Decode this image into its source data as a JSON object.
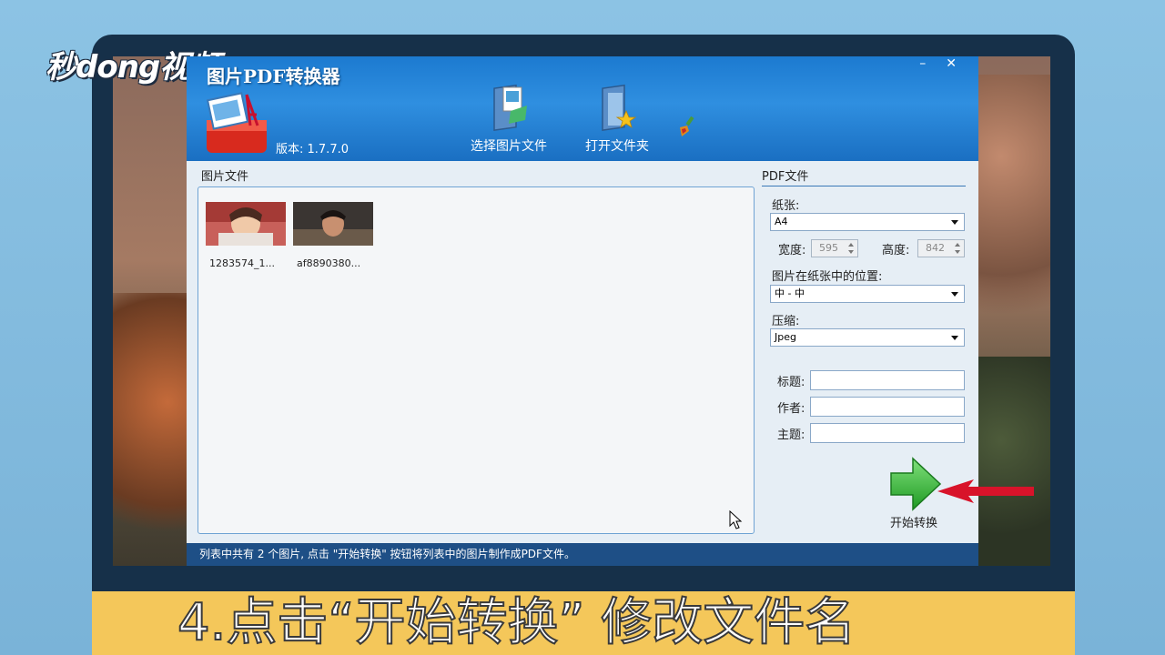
{
  "brand": {
    "logo_text": "秒dong视频"
  },
  "window": {
    "title": "图片PDF转换器",
    "minimize": "–",
    "close": "✕",
    "version": "版本: 1.7.7.0"
  },
  "toolbar": {
    "select_images": "选择图片文件",
    "open_folder": "打开文件夹"
  },
  "image_panel": {
    "label": "图片文件",
    "items": [
      {
        "caption": "1283574_1..."
      },
      {
        "caption": "af8890380..."
      }
    ]
  },
  "pdf_panel": {
    "label": "PDF文件",
    "paper_label": "纸张:",
    "paper_value": "A4",
    "width_label": "宽度:",
    "width_value": "595",
    "height_label": "高度:",
    "height_value": "842",
    "position_label": "图片在纸张中的位置:",
    "position_value": "中 - 中",
    "compress_label": "压缩:",
    "compress_value": "Jpeg",
    "title_label": "标题:",
    "author_label": "作者:",
    "subject_label": "主题:",
    "title_value": "",
    "author_value": "",
    "subject_value": "",
    "start_label": "开始转换"
  },
  "status_bar": {
    "text": "列表中共有 2 个图片, 点击 \"开始转换\" 按钮将列表中的图片制作成PDF文件。"
  },
  "caption": {
    "text": "4.点击“开始转换”  修改文件名"
  },
  "colors": {
    "header_blue": "#1c7ad0",
    "status_blue": "#1e4f86",
    "caption_yellow": "#f4c75a",
    "arrow_red": "#d8132a",
    "start_green": "#39b534"
  }
}
